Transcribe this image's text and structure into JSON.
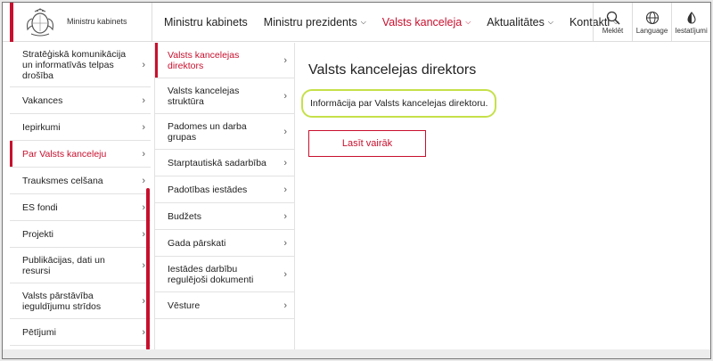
{
  "brand": {
    "name": "Ministru kabinets",
    "accent": "#c8102e"
  },
  "nav": [
    {
      "label": "Ministru kabinets",
      "active": false
    },
    {
      "label": "Ministru prezidents",
      "active": false
    },
    {
      "label": "Valsts kanceleja",
      "active": true
    },
    {
      "label": "Aktualitātes",
      "active": false
    },
    {
      "label": "Kontakti",
      "active": false
    }
  ],
  "tools": {
    "search": "Meklēt",
    "language": "Language",
    "settings": "Iestatījumi"
  },
  "sidebar1": [
    "Stratēģiskā komunikācija un informatīvās telpas drošība",
    "Vakances",
    "Iepirkumi",
    "Par Valsts kanceleju",
    "Trauksmes celšana",
    "ES fondi",
    "Projekti",
    "Publikācijas, dati un resursi",
    "Valsts pārstāvība ieguldījumu strīdos",
    "Pētījumi"
  ],
  "sidebar2": [
    "Valsts kancelejas direktors",
    "Valsts kancelejas struktūra",
    "Padomes un darba grupas",
    "Starptautiskā sadarbība",
    "Padotības iestādes",
    "Budžets",
    "Gada pārskati",
    "Iestādes darbību regulējoši dokumenti",
    "Vēsture"
  ],
  "content": {
    "title": "Valsts kancelejas direktors",
    "info": "Informācija par Valsts kancelejas direktoru.",
    "read_more": "Lasīt vairāk"
  }
}
